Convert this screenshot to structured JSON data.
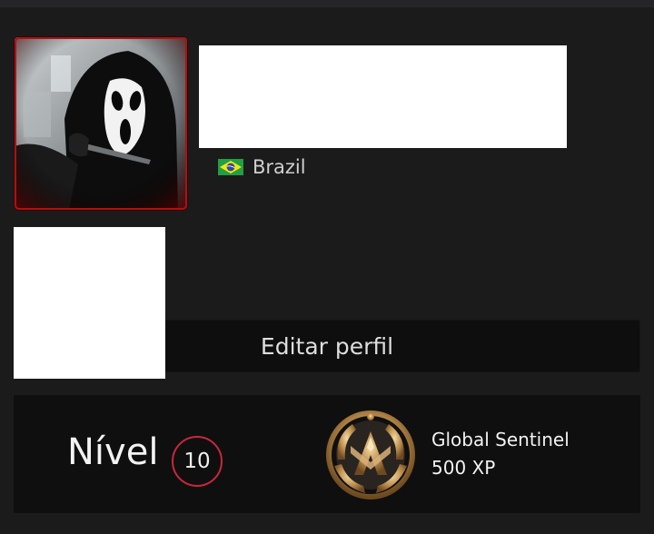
{
  "profile": {
    "country": "Brazil",
    "edit_button_label": "Editar perfil"
  },
  "level": {
    "label": "Nível",
    "value": "10"
  },
  "rank": {
    "name": "Global Sentinel",
    "xp": "500 XP"
  },
  "icons": {
    "avatar": "ghostface-avatar",
    "flag": "brazil-flag-icon",
    "rank_emblem": "global-sentinel-emblem"
  },
  "colors": {
    "background": "#1b1b1c",
    "card": "#0f0f10",
    "level_ring": "#c8283a",
    "avatar_border": "#b01010"
  }
}
